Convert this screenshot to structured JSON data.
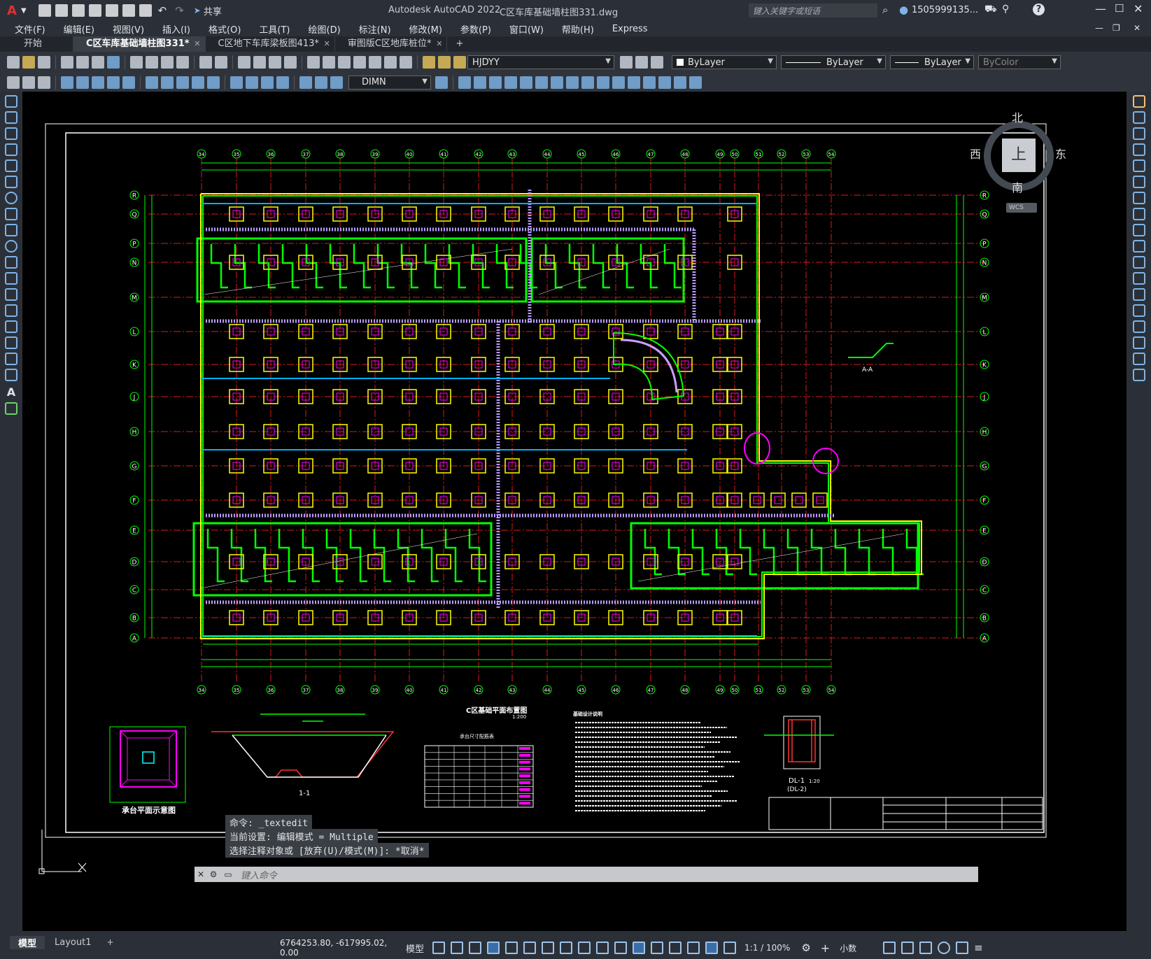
{
  "app": {
    "title": "Autodesk AutoCAD 2022",
    "file_title": "C区车库基础墙柱图331.dwg",
    "logo": "A",
    "share_label": "共享",
    "search_placeholder": "键入关键字或短语",
    "user": "1505999135...",
    "window_controls": [
      "minimize-icon",
      "maximize-icon",
      "close-icon"
    ]
  },
  "menu": [
    "文件(F)",
    "编辑(E)",
    "视图(V)",
    "插入(I)",
    "格式(O)",
    "工具(T)",
    "绘图(D)",
    "标注(N)",
    "修改(M)",
    "参数(P)",
    "窗口(W)",
    "帮助(H)",
    "Express"
  ],
  "tabs": [
    {
      "label": "开始",
      "active": false
    },
    {
      "label": "C区车库基础墙柱图331*",
      "active": true
    },
    {
      "label": "C区地下车库梁板图413*",
      "active": false
    },
    {
      "label": "审图版C区地库桩位*",
      "active": false
    }
  ],
  "properties": {
    "layer": "HJDYY",
    "color": "ByLayer",
    "linetype": "ByLayer",
    "lineweight": "ByLayer",
    "plotstyle": "ByColor",
    "dimstyle": "DIMN"
  },
  "viewcube": {
    "north": "北",
    "south": "南",
    "east": "东",
    "west": "西",
    "top": "上",
    "wcs": "WCS"
  },
  "drawing": {
    "plan_title": "C区基础平面布置图",
    "plan_scale": "1:200",
    "table_title": "承台尺寸配筋表",
    "section_label": "1-1",
    "pile_cap_label": "承台平面示意图",
    "aa_label": "A-A",
    "dl_label": "DL-1",
    "dl_sub": "(DL-2)",
    "dl_scale": "1:20",
    "notes_title": "基础设计说明",
    "row_axes": [
      "R",
      "Q",
      "P",
      "N",
      "M",
      "L",
      "K",
      "J",
      "H",
      "G",
      "F",
      "E",
      "D",
      "C",
      "B",
      "A"
    ],
    "col_axes": [
      "34",
      "35",
      "36",
      "37",
      "38",
      "39",
      "40",
      "41",
      "42",
      "43",
      "44",
      "45",
      "46",
      "47",
      "48",
      "49",
      "50",
      "51",
      "52",
      "53",
      "54"
    ]
  },
  "command": {
    "history": [
      "命令: _textedit",
      "当前设置: 编辑模式 = Multiple",
      "选择注释对象或 [放弃(U)/模式(M)]: *取消*"
    ],
    "placeholder": "键入命令"
  },
  "layout_tabs": [
    "模型",
    "Layout1"
  ],
  "status": {
    "coords": "6764253.80, -617995.02, 0.00",
    "mode": "模型",
    "scale": "1:1 / 100%",
    "units": "小数"
  },
  "colors": {
    "bg": "#000000",
    "wall": "#00ff00",
    "column": "#ffff00",
    "grid": "#ff0000",
    "hatch": "#c8a0ff",
    "dim": "#00ff00",
    "pipe": "#00b0ff",
    "magenta": "#ff00ff"
  }
}
